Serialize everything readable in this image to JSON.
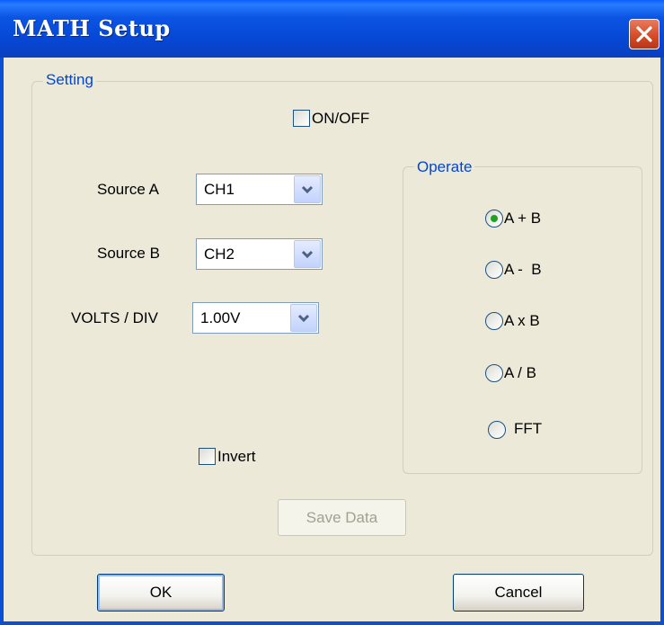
{
  "window": {
    "title": "MATH Setup"
  },
  "setting": {
    "group_label": "Setting",
    "onoff_label": "ON/OFF",
    "onoff_checked": false,
    "source_a": {
      "label": "Source A",
      "value": "CH1"
    },
    "source_b": {
      "label": "Source B",
      "value": "CH2"
    },
    "volts_div": {
      "label": "VOLTS / DIV",
      "value": "1.00V"
    },
    "invert_label": "Invert",
    "invert_checked": false,
    "save_data_label": "Save Data"
  },
  "operate": {
    "group_label": "Operate",
    "options": [
      {
        "label": "A + B",
        "selected": true
      },
      {
        "label": "A -  B",
        "selected": false
      },
      {
        "label": "A x B",
        "selected": false
      },
      {
        "label": "A / B",
        "selected": false
      },
      {
        "label": "FFT",
        "selected": false
      }
    ]
  },
  "buttons": {
    "ok": "OK",
    "cancel": "Cancel"
  },
  "colors": {
    "title_blue": "#0A4FD6",
    "group_label_blue": "#0046D5",
    "radio_selected": "#21A121",
    "close_red": "#D24A25"
  },
  "icons": {
    "close": "close-x-icon",
    "dropdown": "chevron-down-icon"
  }
}
